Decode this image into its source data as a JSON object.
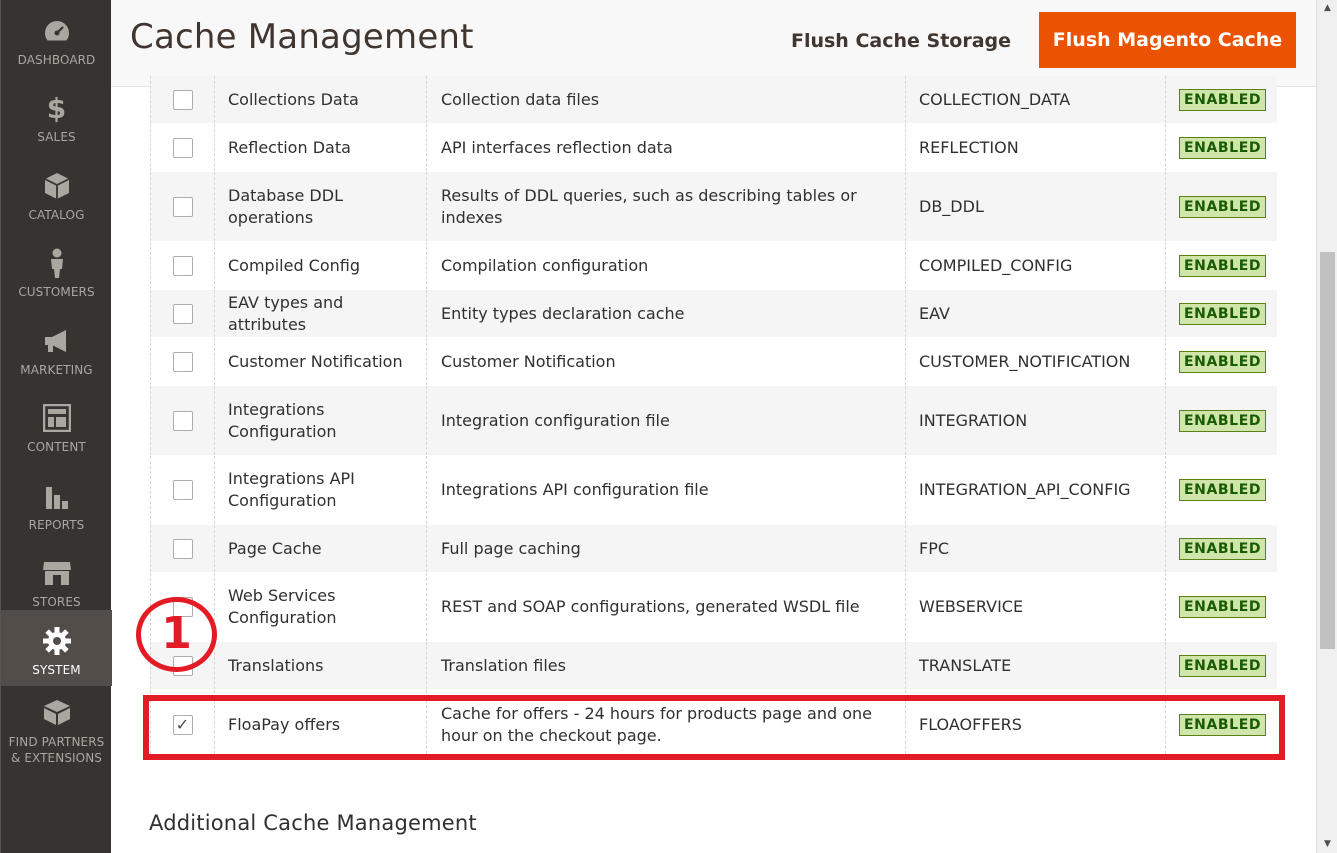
{
  "sidebar": {
    "items": [
      {
        "label": "DASHBOARD",
        "icon": "dashboard-icon"
      },
      {
        "label": "SALES",
        "icon": "dollar-icon"
      },
      {
        "label": "CATALOG",
        "icon": "box-icon"
      },
      {
        "label": "CUSTOMERS",
        "icon": "person-icon"
      },
      {
        "label": "MARKETING",
        "icon": "megaphone-icon"
      },
      {
        "label": "CONTENT",
        "icon": "layout-icon"
      },
      {
        "label": "REPORTS",
        "icon": "bar-chart-icon"
      },
      {
        "label": "STORES",
        "icon": "storefront-icon"
      },
      {
        "label": "SYSTEM",
        "icon": "gear-icon",
        "active": true
      },
      {
        "label": "FIND PARTNERS & EXTENSIONS",
        "icon": "blocks-icon"
      }
    ]
  },
  "header": {
    "title": "Cache Management",
    "flush_storage_label": "Flush Cache Storage",
    "flush_magento_label": "Flush Magento Cache"
  },
  "cache_rows": [
    {
      "name": "Collections Data",
      "description": "Collection data files",
      "tag": "COLLECTION_DATA",
      "status": "ENABLED",
      "checked": false
    },
    {
      "name": "Reflection Data",
      "description": "API interfaces reflection data",
      "tag": "REFLECTION",
      "status": "ENABLED",
      "checked": false
    },
    {
      "name": "Database DDL operations",
      "description": "Results of DDL queries, such as describing tables or indexes",
      "tag": "DB_DDL",
      "status": "ENABLED",
      "checked": false
    },
    {
      "name": "Compiled Config",
      "description": "Compilation configuration",
      "tag": "COMPILED_CONFIG",
      "status": "ENABLED",
      "checked": false
    },
    {
      "name": "EAV types and attributes",
      "description": "Entity types declaration cache",
      "tag": "EAV",
      "status": "ENABLED",
      "checked": false
    },
    {
      "name": "Customer Notification",
      "description": "Customer Notification",
      "tag": "CUSTOMER_NOTIFICATION",
      "status": "ENABLED",
      "checked": false
    },
    {
      "name": "Integrations Configuration",
      "description": "Integration configuration file",
      "tag": "INTEGRATION",
      "status": "ENABLED",
      "checked": false
    },
    {
      "name": "Integrations API Configuration",
      "description": "Integrations API configuration file",
      "tag": "INTEGRATION_API_CONFIG",
      "status": "ENABLED",
      "checked": false
    },
    {
      "name": "Page Cache",
      "description": "Full page caching",
      "tag": "FPC",
      "status": "ENABLED",
      "checked": false
    },
    {
      "name": "Web Services Configuration",
      "description": "REST and SOAP configurations, generated WSDL file",
      "tag": "WEBSERVICE",
      "status": "ENABLED",
      "checked": false
    },
    {
      "name": "Translations",
      "description": "Translation files",
      "tag": "TRANSLATE",
      "status": "ENABLED",
      "checked": false
    },
    {
      "name": "FloaPay offers",
      "description": "Cache for offers - 24 hours for products page and one hour on the checkout page.",
      "tag": "FLOAOFFERS",
      "status": "ENABLED",
      "checked": true
    }
  ],
  "annotation": {
    "step_number": "1"
  },
  "additional_section_title": "Additional Cache Management",
  "colors": {
    "sidebar_bg": "#373330",
    "accent_orange": "#eb5202",
    "highlight_red": "#e31b24",
    "status_green_bg": "#d0e5a9"
  }
}
